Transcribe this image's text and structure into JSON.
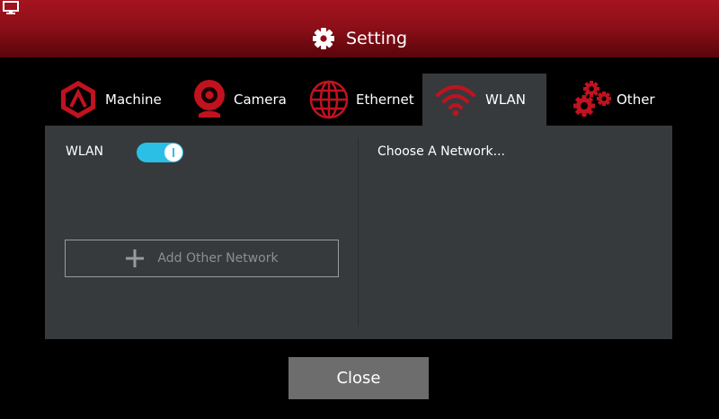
{
  "window": {
    "title": "Setting",
    "icon": "monitor-icon",
    "title_icon": "gear-icon"
  },
  "tabs": [
    {
      "label": "Machine",
      "icon": "machine-logo-icon",
      "active": false
    },
    {
      "label": "Camera",
      "icon": "webcam-icon",
      "active": false
    },
    {
      "label": "Ethernet",
      "icon": "globe-icon",
      "active": false
    },
    {
      "label": "WLAN",
      "icon": "wifi-icon",
      "active": true
    },
    {
      "label": "Other",
      "icon": "gears-icon",
      "active": false
    }
  ],
  "wlan": {
    "label": "WLAN",
    "enabled": true,
    "add_network_label": "Add Other Network",
    "choose_network_label": "Choose A Network..."
  },
  "footer": {
    "close_label": "Close"
  },
  "colors": {
    "accent_red": "#c1121f",
    "toggle_on": "#2bbfe5",
    "panel_bg": "#373a3d",
    "close_button": "#6d6d6d"
  }
}
